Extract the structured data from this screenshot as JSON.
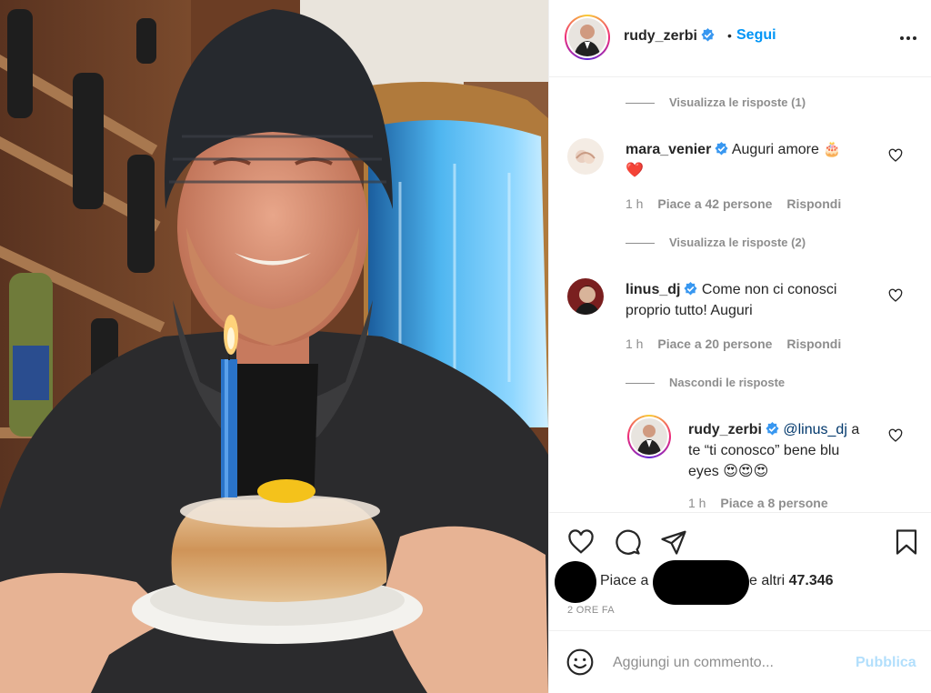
{
  "post": {
    "username": "rudy_zerbi",
    "dot": "•",
    "follow_label": "Segui"
  },
  "comments": [
    {
      "type": "toggle",
      "label": "Visualizza le risposte (1)"
    },
    {
      "type": "comment",
      "user": "mara_venier",
      "text": "Auguri amore 🎂",
      "text2": "❤️",
      "time": "1 h",
      "likes": "Piace a 42 persone",
      "reply": "Rispondi"
    },
    {
      "type": "toggle",
      "label": "Visualizza le risposte (2)"
    },
    {
      "type": "comment",
      "user": "linus_dj",
      "text": "Come non ci conosci",
      "text2": "proprio tutto! Auguri",
      "time": "1 h",
      "likes": "Piace a 20 persone",
      "reply": "Rispondi"
    },
    {
      "type": "toggle",
      "label": "Nascondi le risposte"
    },
    {
      "type": "reply",
      "user": "rudy_zerbi",
      "mention": "@linus_dj",
      "text": "a",
      "text2": "te “ti conosco” bene blu",
      "text3": "eyes 😍😍😍",
      "time": "1 h",
      "likes": "Piace a 8 persone"
    }
  ],
  "likes_bar": {
    "prefix": "Piace a",
    "suffix_pre": "e altri",
    "count": "47.346",
    "time_ago": "2 ORE FA"
  },
  "compose": {
    "placeholder": "Aggiungi un commento...",
    "publish_label": "Pubblica"
  },
  "icons": {
    "more": "more-horizontal-icon",
    "like": "heart-icon",
    "comment": "comment-bubble-icon",
    "share": "paper-plane-icon",
    "save": "bookmark-icon",
    "emoji": "smiley-icon"
  },
  "colors": {
    "link": "#0095f6",
    "verified": "#3897f0",
    "muted": "#8e8e8e",
    "publish_disabled": "#b2dffc"
  }
}
